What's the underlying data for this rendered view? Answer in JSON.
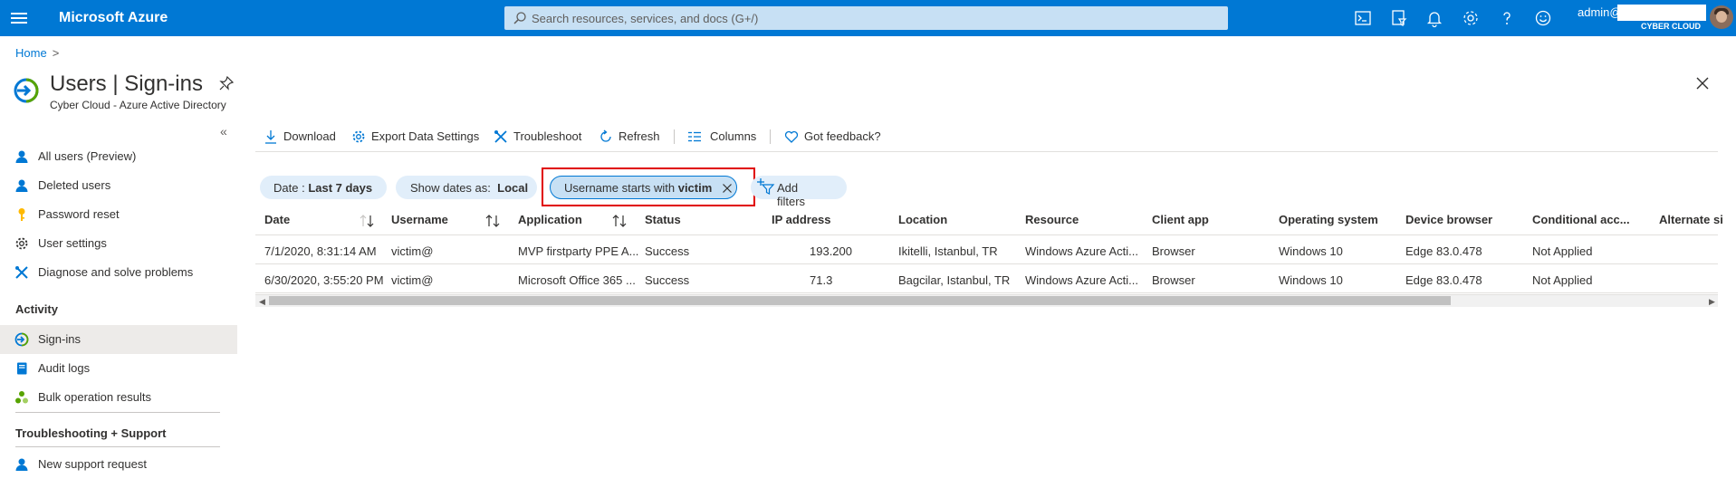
{
  "topbar": {
    "brand": "Microsoft Azure",
    "search_placeholder": "Search resources, services, and docs (G+/)",
    "user": "admin@",
    "tenant": "CYBER CLOUD",
    "icons": [
      "cloud-shell-icon",
      "directory-filter-icon",
      "notifications-icon",
      "settings-icon",
      "help-icon",
      "feedback-smiley-icon"
    ]
  },
  "breadcrumb": {
    "home": "Home",
    "sep": ">"
  },
  "page": {
    "title_main": "Users",
    "title_sep": "|",
    "title_sub": "Sign-ins",
    "subtitle": "Cyber Cloud - Azure Active Directory"
  },
  "sidebar": {
    "collapse": "«",
    "items": [
      {
        "label": "All users (Preview)",
        "icon": "user-icon"
      },
      {
        "label": "Deleted users",
        "icon": "user-icon"
      },
      {
        "label": "Password reset",
        "icon": "key-icon"
      },
      {
        "label": "User settings",
        "icon": "gear-icon"
      },
      {
        "label": "Diagnose and solve problems",
        "icon": "wrench-icon"
      }
    ],
    "section_activity": "Activity",
    "activity_items": [
      {
        "label": "Sign-ins",
        "icon": "signin-icon",
        "active": true
      },
      {
        "label": "Audit logs",
        "icon": "book-icon"
      },
      {
        "label": "Bulk operation results",
        "icon": "bulk-icon"
      }
    ],
    "section_support": "Troubleshooting + Support",
    "support_items": [
      {
        "label": "New support request",
        "icon": "user-icon"
      }
    ]
  },
  "toolbar": {
    "download": "Download",
    "export": "Export Data Settings",
    "troubleshoot": "Troubleshoot",
    "refresh": "Refresh",
    "columns": "Columns",
    "feedback": "Got feedback?"
  },
  "filters": {
    "date_label": "Date :",
    "date_value": "Last 7 days",
    "show_dates_label": "Show dates as:",
    "show_dates_value": "Local",
    "username_label": "Username starts with",
    "username_value": "victim",
    "add_filters": "Add filters"
  },
  "table": {
    "columns": [
      "Date",
      "Username",
      "Application",
      "Status",
      "IP address",
      "Location",
      "Resource",
      "Client app",
      "Operating system",
      "Device browser",
      "Conditional acc...",
      "Alternate si"
    ],
    "rows": [
      {
        "date": "7/1/2020, 8:31:14 AM",
        "username": "victim@",
        "application": "MVP firstparty PPE A...",
        "status": "Success",
        "ip": "193.200",
        "location": "Ikitelli, Istanbul, TR",
        "resource": "Windows Azure Acti...",
        "client_app": "Browser",
        "os": "Windows 10",
        "browser": "Edge 83.0.478",
        "conditional": "Not Applied"
      },
      {
        "date": "6/30/2020, 3:55:20 PM",
        "username": "victim@",
        "application": "Microsoft Office 365 ...",
        "status": "Success",
        "ip": "71.3",
        "location": "Bagcilar, Istanbul, TR",
        "resource": "Windows Azure Acti...",
        "client_app": "Browser",
        "os": "Windows 10",
        "browser": "Edge 83.0.478",
        "conditional": "Not Applied"
      }
    ]
  },
  "colors": {
    "brand": "#0078d4",
    "highlight_box": "#e00000",
    "pill": "#e1eefa"
  }
}
